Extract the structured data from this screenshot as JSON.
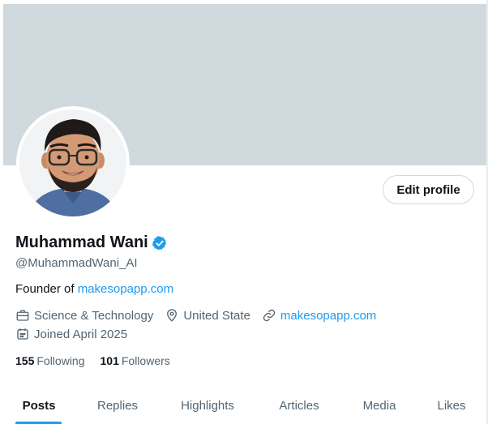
{
  "profile": {
    "name": "Muhammad Wani",
    "handle": "@MuhammadWani_AI",
    "bio_prefix": "Founder of ",
    "bio_link": "makesopapp.com",
    "category": "Science & Technology",
    "location": "United State",
    "website": "makesopapp.com",
    "joined": "Joined April 2025",
    "following_count": "155",
    "following_label": "Following",
    "followers_count": "101",
    "followers_label": "Followers"
  },
  "actions": {
    "edit_profile": "Edit profile"
  },
  "tabs": [
    {
      "label": "Posts",
      "active": true
    },
    {
      "label": "Replies",
      "active": false
    },
    {
      "label": "Highlights",
      "active": false
    },
    {
      "label": "Articles",
      "active": false
    },
    {
      "label": "Media",
      "active": false
    },
    {
      "label": "Likes",
      "active": false
    }
  ],
  "icons": {
    "verified": "verified-badge-icon",
    "category": "briefcase-icon",
    "location": "location-pin-icon",
    "website": "link-icon",
    "joined": "calendar-icon"
  },
  "colors": {
    "banner": "#cfd9de",
    "accent": "#1d9bf0",
    "text_primary": "#0f1419",
    "text_secondary": "#536471"
  }
}
